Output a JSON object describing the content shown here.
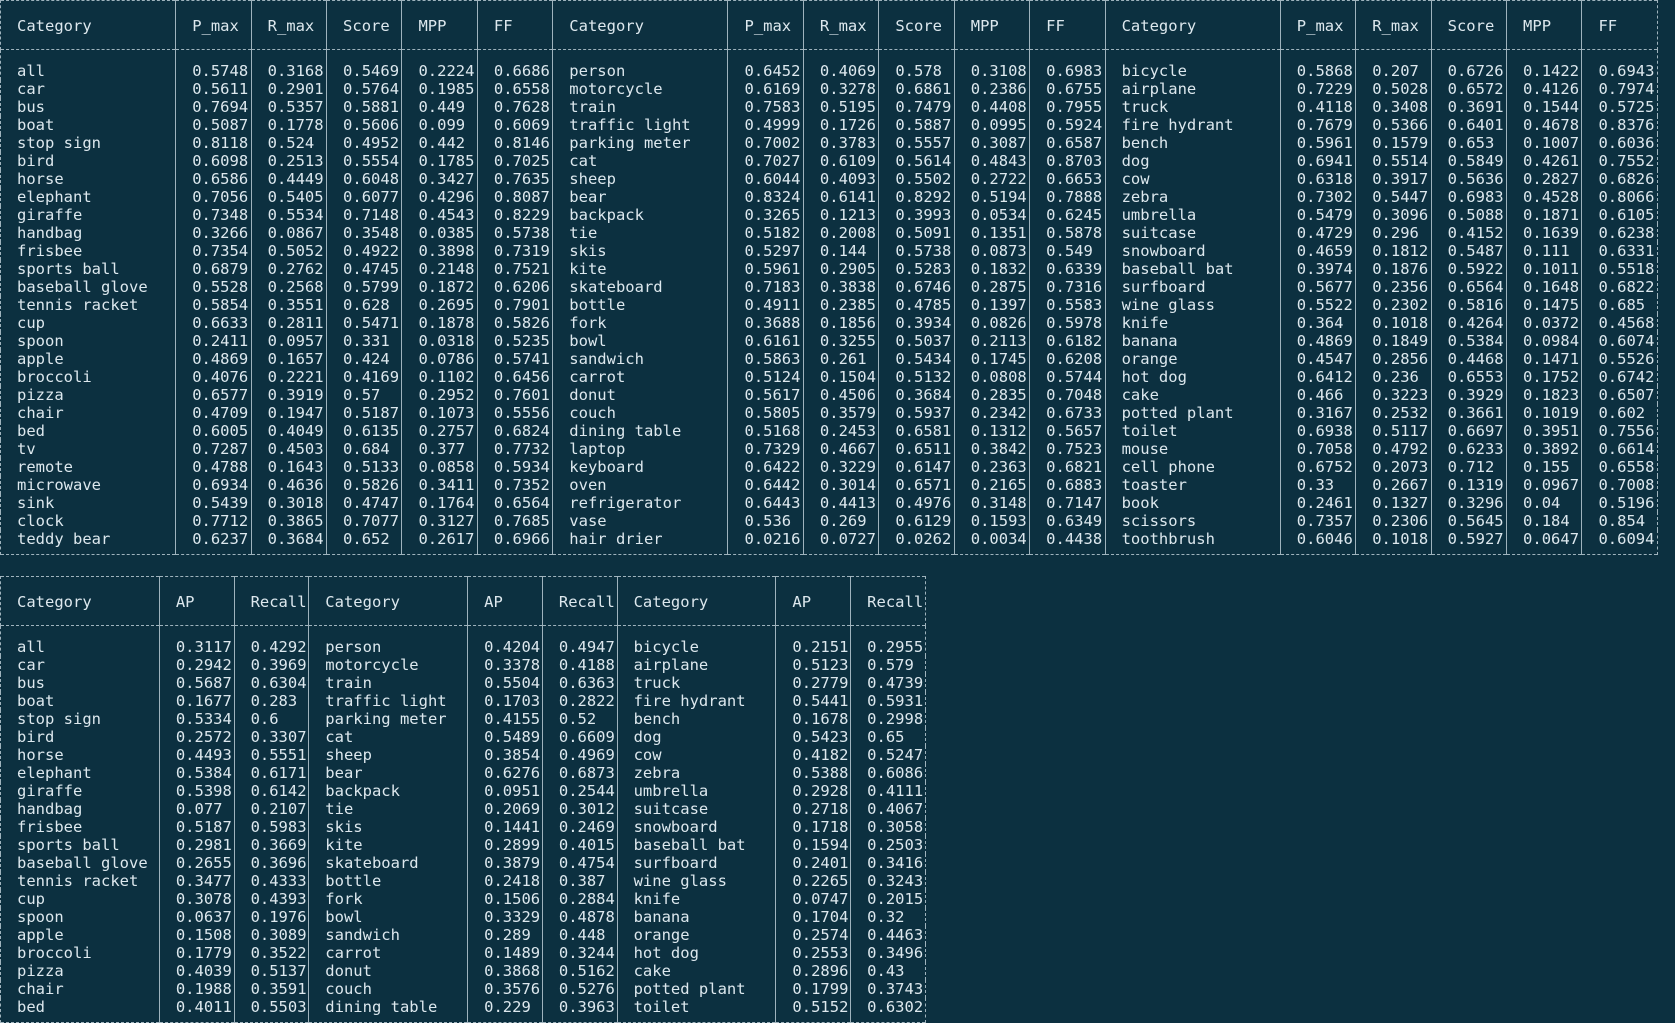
{
  "table1": {
    "headers": [
      "Category",
      "P_max",
      "R_max",
      "Score",
      "MPP",
      "FF",
      "Category",
      "P_max",
      "R_max",
      "Score",
      "MPP",
      "FF",
      "Category",
      "P_max",
      "R_max",
      "Score",
      "MPP",
      "FF"
    ],
    "rows": [
      [
        "all",
        "0.5748",
        "0.3168",
        "0.5469",
        "0.2224",
        "0.6686",
        "person",
        "0.6452",
        "0.4069",
        "0.578",
        "0.3108",
        "0.6983",
        "bicycle",
        "0.5868",
        "0.207",
        "0.6726",
        "0.1422",
        "0.6943"
      ],
      [
        "car",
        "0.5611",
        "0.2901",
        "0.5764",
        "0.1985",
        "0.6558",
        "motorcycle",
        "0.6169",
        "0.3278",
        "0.6861",
        "0.2386",
        "0.6755",
        "airplane",
        "0.7229",
        "0.5028",
        "0.6572",
        "0.4126",
        "0.7974"
      ],
      [
        "bus",
        "0.7694",
        "0.5357",
        "0.5881",
        "0.449",
        "0.7628",
        "train",
        "0.7583",
        "0.5195",
        "0.7479",
        "0.4408",
        "0.7955",
        "truck",
        "0.4118",
        "0.3408",
        "0.3691",
        "0.1544",
        "0.5725"
      ],
      [
        "boat",
        "0.5087",
        "0.1778",
        "0.5606",
        "0.099",
        "0.6069",
        "traffic light",
        "0.4999",
        "0.1726",
        "0.5887",
        "0.0995",
        "0.5924",
        "fire hydrant",
        "0.7679",
        "0.5366",
        "0.6401",
        "0.4678",
        "0.8376"
      ],
      [
        "stop sign",
        "0.8118",
        "0.524",
        "0.4952",
        "0.442",
        "0.8146",
        "parking meter",
        "0.7002",
        "0.3783",
        "0.5557",
        "0.3087",
        "0.6587",
        "bench",
        "0.5961",
        "0.1579",
        "0.653",
        "0.1007",
        "0.6036"
      ],
      [
        "bird",
        "0.6098",
        "0.2513",
        "0.5554",
        "0.1785",
        "0.7025",
        "cat",
        "0.7027",
        "0.6109",
        "0.5614",
        "0.4843",
        "0.8703",
        "dog",
        "0.6941",
        "0.5514",
        "0.5849",
        "0.4261",
        "0.7552"
      ],
      [
        "horse",
        "0.6586",
        "0.4449",
        "0.6048",
        "0.3427",
        "0.7635",
        "sheep",
        "0.6044",
        "0.4093",
        "0.5502",
        "0.2722",
        "0.6653",
        "cow",
        "0.6318",
        "0.3917",
        "0.5636",
        "0.2827",
        "0.6826"
      ],
      [
        "elephant",
        "0.7056",
        "0.5405",
        "0.6077",
        "0.4296",
        "0.8087",
        "bear",
        "0.8324",
        "0.6141",
        "0.8292",
        "0.5194",
        "0.7888",
        "zebra",
        "0.7302",
        "0.5447",
        "0.6983",
        "0.4528",
        "0.8066"
      ],
      [
        "giraffe",
        "0.7348",
        "0.5534",
        "0.7148",
        "0.4543",
        "0.8229",
        "backpack",
        "0.3265",
        "0.1213",
        "0.3993",
        "0.0534",
        "0.6245",
        "umbrella",
        "0.5479",
        "0.3096",
        "0.5088",
        "0.1871",
        "0.6105"
      ],
      [
        "handbag",
        "0.3266",
        "0.0867",
        "0.3548",
        "0.0385",
        "0.5738",
        "tie",
        "0.5182",
        "0.2008",
        "0.5091",
        "0.1351",
        "0.5878",
        "suitcase",
        "0.4729",
        "0.296",
        "0.4152",
        "0.1639",
        "0.6238"
      ],
      [
        "frisbee",
        "0.7354",
        "0.5052",
        "0.4922",
        "0.3898",
        "0.7319",
        "skis",
        "0.5297",
        "0.144",
        "0.5738",
        "0.0873",
        "0.549",
        "snowboard",
        "0.4659",
        "0.1812",
        "0.5487",
        "0.111",
        "0.6331"
      ],
      [
        "sports ball",
        "0.6879",
        "0.2762",
        "0.4745",
        "0.2148",
        "0.7521",
        "kite",
        "0.5961",
        "0.2905",
        "0.5283",
        "0.1832",
        "0.6339",
        "baseball bat",
        "0.3974",
        "0.1876",
        "0.5922",
        "0.1011",
        "0.5518"
      ],
      [
        "baseball glove",
        "0.5528",
        "0.2568",
        "0.5799",
        "0.1872",
        "0.6206",
        "skateboard",
        "0.7183",
        "0.3838",
        "0.6746",
        "0.2875",
        "0.7316",
        "surfboard",
        "0.5677",
        "0.2356",
        "0.6564",
        "0.1648",
        "0.6822"
      ],
      [
        "tennis racket",
        "0.5854",
        "0.3551",
        "0.628",
        "0.2695",
        "0.7901",
        "bottle",
        "0.4911",
        "0.2385",
        "0.4785",
        "0.1397",
        "0.5583",
        "wine glass",
        "0.5522",
        "0.2302",
        "0.5816",
        "0.1475",
        "0.685"
      ],
      [
        "cup",
        "0.6633",
        "0.2811",
        "0.5471",
        "0.1878",
        "0.5826",
        "fork",
        "0.3688",
        "0.1856",
        "0.3934",
        "0.0826",
        "0.5978",
        "knife",
        "0.364",
        "0.1018",
        "0.4264",
        "0.0372",
        "0.4568"
      ],
      [
        "spoon",
        "0.2411",
        "0.0957",
        "0.331",
        "0.0318",
        "0.5235",
        "bowl",
        "0.6161",
        "0.3255",
        "0.5037",
        "0.2113",
        "0.6182",
        "banana",
        "0.4869",
        "0.1849",
        "0.5384",
        "0.0984",
        "0.6074"
      ],
      [
        "apple",
        "0.4869",
        "0.1657",
        "0.424",
        "0.0786",
        "0.5741",
        "sandwich",
        "0.5863",
        "0.261",
        "0.5434",
        "0.1745",
        "0.6208",
        "orange",
        "0.4547",
        "0.2856",
        "0.4468",
        "0.1471",
        "0.5526"
      ],
      [
        "broccoli",
        "0.4076",
        "0.2221",
        "0.4169",
        "0.1102",
        "0.6456",
        "carrot",
        "0.5124",
        "0.1504",
        "0.5132",
        "0.0808",
        "0.5744",
        "hot dog",
        "0.6412",
        "0.236",
        "0.6553",
        "0.1752",
        "0.6742"
      ],
      [
        "pizza",
        "0.6577",
        "0.3919",
        "0.57",
        "0.2952",
        "0.7601",
        "donut",
        "0.5617",
        "0.4506",
        "0.3684",
        "0.2835",
        "0.7048",
        "cake",
        "0.466",
        "0.3223",
        "0.3929",
        "0.1823",
        "0.6507"
      ],
      [
        "chair",
        "0.4709",
        "0.1947",
        "0.5187",
        "0.1073",
        "0.5556",
        "couch",
        "0.5805",
        "0.3579",
        "0.5937",
        "0.2342",
        "0.6733",
        "potted plant",
        "0.3167",
        "0.2532",
        "0.3661",
        "0.1019",
        "0.602"
      ],
      [
        "bed",
        "0.6005",
        "0.4049",
        "0.6135",
        "0.2757",
        "0.6824",
        "dining table",
        "0.5168",
        "0.2453",
        "0.6581",
        "0.1312",
        "0.5657",
        "toilet",
        "0.6938",
        "0.5117",
        "0.6697",
        "0.3951",
        "0.7556"
      ],
      [
        "tv",
        "0.7287",
        "0.4503",
        "0.684",
        "0.377",
        "0.7732",
        "laptop",
        "0.7329",
        "0.4667",
        "0.6511",
        "0.3842",
        "0.7523",
        "mouse",
        "0.7058",
        "0.4792",
        "0.6233",
        "0.3892",
        "0.6614"
      ],
      [
        "remote",
        "0.4788",
        "0.1643",
        "0.5133",
        "0.0858",
        "0.5934",
        "keyboard",
        "0.6422",
        "0.3229",
        "0.6147",
        "0.2363",
        "0.6821",
        "cell phone",
        "0.6752",
        "0.2073",
        "0.712",
        "0.155",
        "0.6558"
      ],
      [
        "microwave",
        "0.6934",
        "0.4636",
        "0.5826",
        "0.3411",
        "0.7352",
        "oven",
        "0.6442",
        "0.3014",
        "0.6571",
        "0.2165",
        "0.6883",
        "toaster",
        "0.33",
        "0.2667",
        "0.1319",
        "0.0967",
        "0.7008"
      ],
      [
        "sink",
        "0.5439",
        "0.3018",
        "0.4747",
        "0.1764",
        "0.6564",
        "refrigerator",
        "0.6443",
        "0.4413",
        "0.4976",
        "0.3148",
        "0.7147",
        "book",
        "0.2461",
        "0.1327",
        "0.3296",
        "0.04",
        "0.5196"
      ],
      [
        "clock",
        "0.7712",
        "0.3865",
        "0.7077",
        "0.3127",
        "0.7685",
        "vase",
        "0.536",
        "0.269",
        "0.6129",
        "0.1593",
        "0.6349",
        "scissors",
        "0.7357",
        "0.2306",
        "0.5645",
        "0.184",
        "0.854"
      ],
      [
        "teddy bear",
        "0.6237",
        "0.3684",
        "0.652",
        "0.2617",
        "0.6966",
        "hair drier",
        "0.0216",
        "0.0727",
        "0.0262",
        "0.0034",
        "0.4438",
        "toothbrush",
        "0.6046",
        "0.1018",
        "0.5927",
        "0.0647",
        "0.6094"
      ]
    ]
  },
  "table2": {
    "headers": [
      "Category",
      "AP",
      "Recall",
      "Category",
      "AP",
      "Recall",
      "Category",
      "AP",
      "Recall"
    ],
    "rows": [
      [
        "all",
        "0.3117",
        "0.4292",
        "person",
        "0.4204",
        "0.4947",
        "bicycle",
        "0.2151",
        "0.2955"
      ],
      [
        "car",
        "0.2942",
        "0.3969",
        "motorcycle",
        "0.3378",
        "0.4188",
        "airplane",
        "0.5123",
        "0.579"
      ],
      [
        "bus",
        "0.5687",
        "0.6304",
        "train",
        "0.5504",
        "0.6363",
        "truck",
        "0.2779",
        "0.4739"
      ],
      [
        "boat",
        "0.1677",
        "0.283",
        "traffic light",
        "0.1703",
        "0.2822",
        "fire hydrant",
        "0.5441",
        "0.5931"
      ],
      [
        "stop sign",
        "0.5334",
        "0.6",
        "parking meter",
        "0.4155",
        "0.52",
        "bench",
        "0.1678",
        "0.2998"
      ],
      [
        "bird",
        "0.2572",
        "0.3307",
        "cat",
        "0.5489",
        "0.6609",
        "dog",
        "0.5423",
        "0.65"
      ],
      [
        "horse",
        "0.4493",
        "0.5551",
        "sheep",
        "0.3854",
        "0.4969",
        "cow",
        "0.4182",
        "0.5247"
      ],
      [
        "elephant",
        "0.5384",
        "0.6171",
        "bear",
        "0.6276",
        "0.6873",
        "zebra",
        "0.5388",
        "0.6086"
      ],
      [
        "giraffe",
        "0.5398",
        "0.6142",
        "backpack",
        "0.0951",
        "0.2544",
        "umbrella",
        "0.2928",
        "0.4111"
      ],
      [
        "handbag",
        "0.077",
        "0.2107",
        "tie",
        "0.2069",
        "0.3012",
        "suitcase",
        "0.2718",
        "0.4067"
      ],
      [
        "frisbee",
        "0.5187",
        "0.5983",
        "skis",
        "0.1441",
        "0.2469",
        "snowboard",
        "0.1718",
        "0.3058"
      ],
      [
        "sports ball",
        "0.2981",
        "0.3669",
        "kite",
        "0.2899",
        "0.4015",
        "baseball bat",
        "0.1594",
        "0.2503"
      ],
      [
        "baseball glove",
        "0.2655",
        "0.3696",
        "skateboard",
        "0.3879",
        "0.4754",
        "surfboard",
        "0.2401",
        "0.3416"
      ],
      [
        "tennis racket",
        "0.3477",
        "0.4333",
        "bottle",
        "0.2418",
        "0.387",
        "wine glass",
        "0.2265",
        "0.3243"
      ],
      [
        "cup",
        "0.3078",
        "0.4393",
        "fork",
        "0.1506",
        "0.2884",
        "knife",
        "0.0747",
        "0.2015"
      ],
      [
        "spoon",
        "0.0637",
        "0.1976",
        "bowl",
        "0.3329",
        "0.4878",
        "banana",
        "0.1704",
        "0.32"
      ],
      [
        "apple",
        "0.1508",
        "0.3089",
        "sandwich",
        "0.289",
        "0.448",
        "orange",
        "0.2574",
        "0.4463"
      ],
      [
        "broccoli",
        "0.1779",
        "0.3522",
        "carrot",
        "0.1489",
        "0.3244",
        "hot dog",
        "0.2553",
        "0.3496"
      ],
      [
        "pizza",
        "0.4039",
        "0.5137",
        "donut",
        "0.3868",
        "0.5162",
        "cake",
        "0.2896",
        "0.43"
      ],
      [
        "chair",
        "0.1988",
        "0.3591",
        "couch",
        "0.3576",
        "0.5276",
        "potted plant",
        "0.1799",
        "0.3743"
      ],
      [
        "bed",
        "0.4011",
        "0.5503",
        "dining table",
        "0.229",
        "0.3963",
        "toilet",
        "0.5152",
        "0.6302"
      ]
    ]
  }
}
